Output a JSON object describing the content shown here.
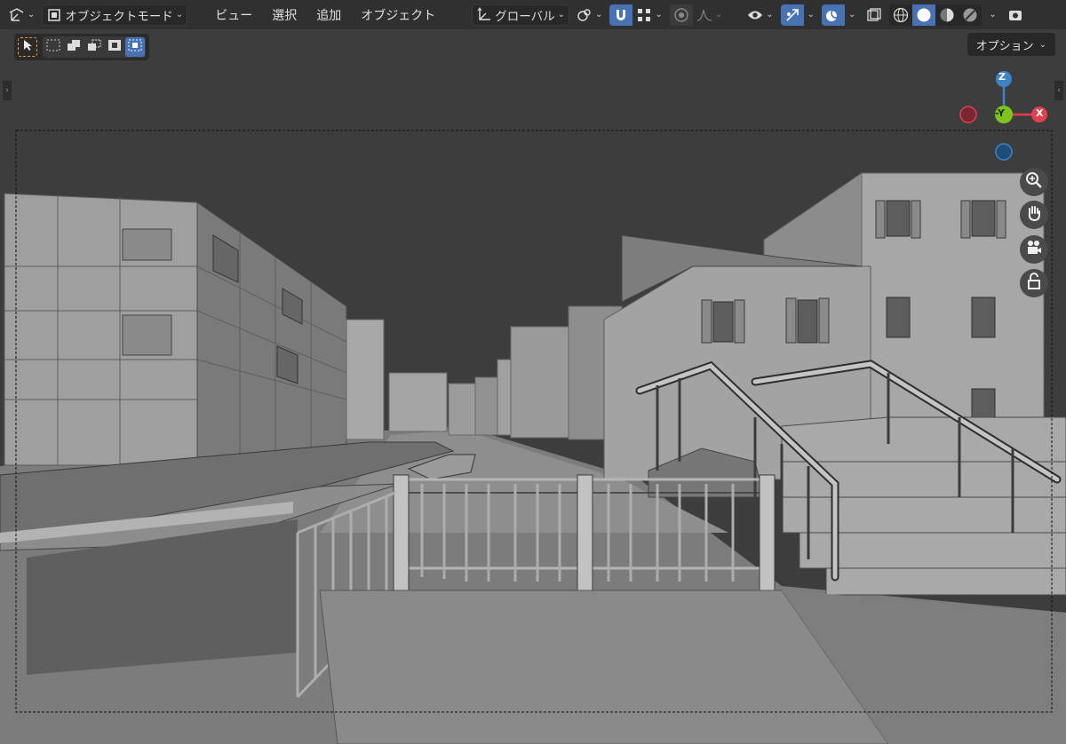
{
  "header": {
    "mode_label": "オブジェクトモード",
    "menus": [
      "ビュー",
      "選択",
      "追加",
      "オブジェクト"
    ],
    "transform_orientation": "グローバル"
  },
  "viewport": {
    "options_label": "オプション",
    "gizmo": {
      "z": "Z",
      "y": "-Y",
      "x": "X"
    }
  },
  "colors": {
    "accent": "#4772b3",
    "axis_x": "#e0404f",
    "axis_y": "#7fc41a",
    "axis_z": "#3d85c6"
  }
}
